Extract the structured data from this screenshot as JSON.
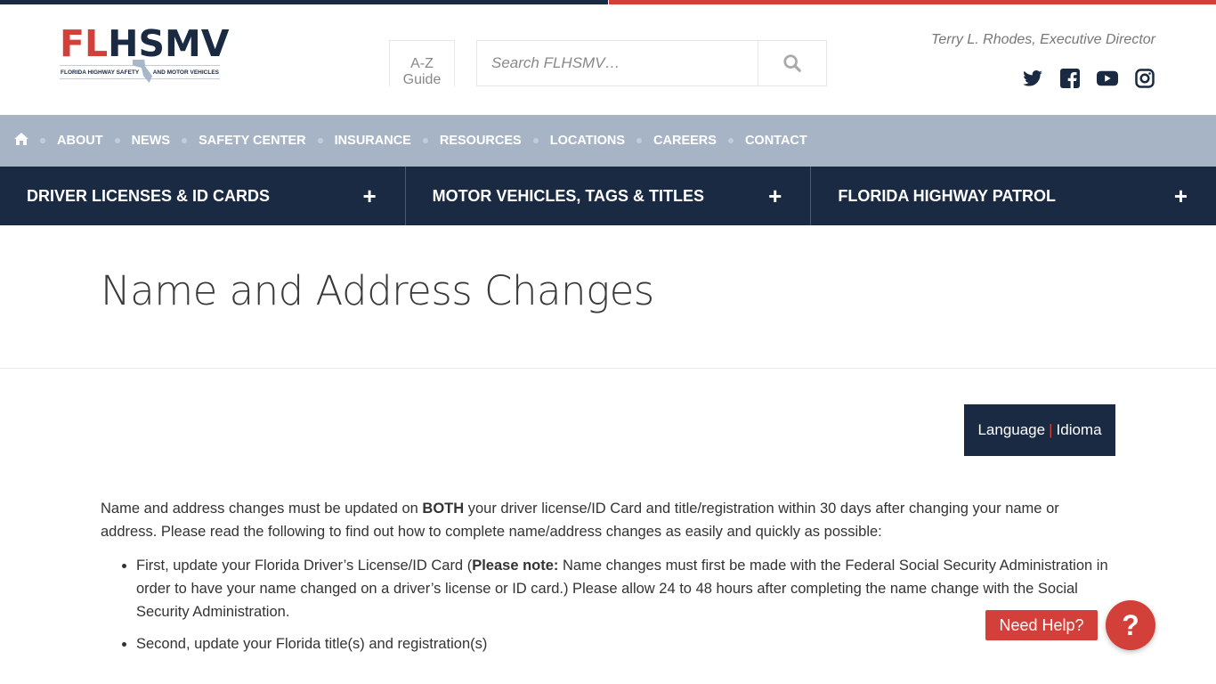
{
  "brand": {
    "logo_part1": "FL",
    "logo_part2": "HSMV",
    "tagline_left": "FLORIDA HIGHWAY SAFETY",
    "tagline_right": "AND MOTOR VEHICLES",
    "colors": {
      "navy": "#1a2a42",
      "red": "#d33f39",
      "util_nav": "#a7b4c6"
    }
  },
  "header": {
    "az_line1": "A-Z",
    "az_line2": "Guide",
    "search_placeholder": "Search FLHSMV…",
    "search_value": "",
    "director": "Terry L. Rhodes, Executive Director",
    "social": [
      "twitter-icon",
      "facebook-icon",
      "youtube-icon",
      "instagram-icon"
    ]
  },
  "util_nav": {
    "home_icon": "home-icon",
    "items": [
      "ABOUT",
      "NEWS",
      "SAFETY CENTER",
      "INSURANCE",
      "RESOURCES",
      "LOCATIONS",
      "CAREERS",
      "CONTACT"
    ]
  },
  "main_nav": {
    "items": [
      {
        "label": "DRIVER LICENSES & ID CARDS",
        "expand": "+"
      },
      {
        "label": "MOTOR VEHICLES, TAGS & TITLES",
        "expand": "+"
      },
      {
        "label": "FLORIDA HIGHWAY PATROL",
        "expand": "+"
      }
    ]
  },
  "page": {
    "title": "Name and Address Changes",
    "language_left": "Language",
    "language_sep": "|",
    "language_right": "Idioma",
    "intro_pre": "Name and address changes must be updated on ",
    "intro_bold": "BOTH",
    "intro_post": " your driver license/ID Card and title/registration within 30 days after changing your name or address. Please read the following to find out how to complete name/address changes as easily and quickly as possible:",
    "bullets": [
      {
        "pre": "First, update your Florida Driver’s License/ID Card (",
        "bold": "Please note:",
        "post": " Name changes must first be made with the Federal Social Security Administration in order to have your name changed on a driver’s license or ID card.) Please allow 24 to 48 hours after completing the name change with the Social Security Administration."
      },
      {
        "pre": "Second, update your Florida title(s) and registration(s)",
        "bold": "",
        "post": ""
      }
    ]
  },
  "help": {
    "label": "Need Help?",
    "icon": "?"
  }
}
